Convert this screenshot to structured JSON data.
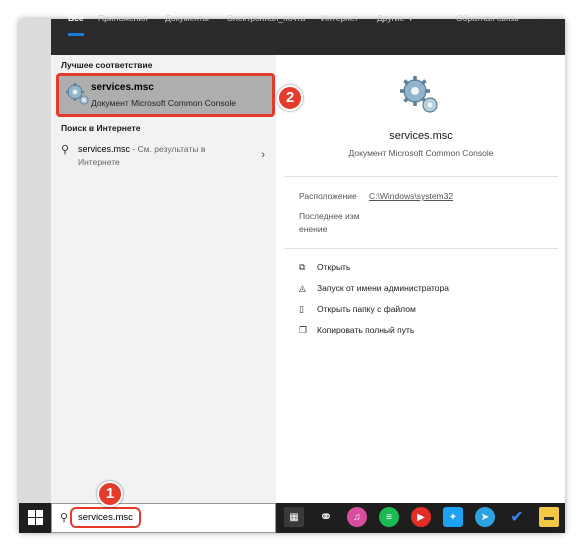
{
  "tabs": [
    {
      "label": "Все"
    },
    {
      "label": "Приложения"
    },
    {
      "label": "Документы"
    },
    {
      "label": "Электронная_почта"
    },
    {
      "label": "Интернет"
    },
    {
      "label": "Другие"
    }
  ],
  "feedback_label": "Обратная связь",
  "more_label": "···",
  "left": {
    "best_match_heading": "Лучшее соответствие",
    "best_match": {
      "title": "services.msc",
      "subtitle": "Документ Microsoft Common Console"
    },
    "web_heading": "Поиск в Интернете",
    "web_result": {
      "query": "services.msc",
      "hint": " - См. результаты в",
      "hint_line2": "Интернете"
    }
  },
  "right": {
    "title": "services.msc",
    "subtitle": "Документ Microsoft Common Console",
    "location_label": "Расположение",
    "location_value": "C:\\Windows\\system32",
    "modified_label_1": "Последнее изм",
    "modified_label_2": "енение",
    "actions": [
      {
        "label": "Открыть",
        "icon": "open-icon"
      },
      {
        "label": "Запуск от имени администратора",
        "icon": "run-as-admin-icon"
      },
      {
        "label": "Открыть папку с файлом",
        "icon": "open-folder-icon"
      },
      {
        "label": "Копировать полный путь",
        "icon": "copy-path-icon"
      }
    ]
  },
  "taskbar": {
    "search_value": "services.msc"
  },
  "callouts": {
    "one": "1",
    "two": "2"
  },
  "colors": {
    "accent": "#1a78d6",
    "callout": "#e43b2c",
    "tabbar": "#2b2b2b",
    "taskbar": "#1e1e1e"
  }
}
